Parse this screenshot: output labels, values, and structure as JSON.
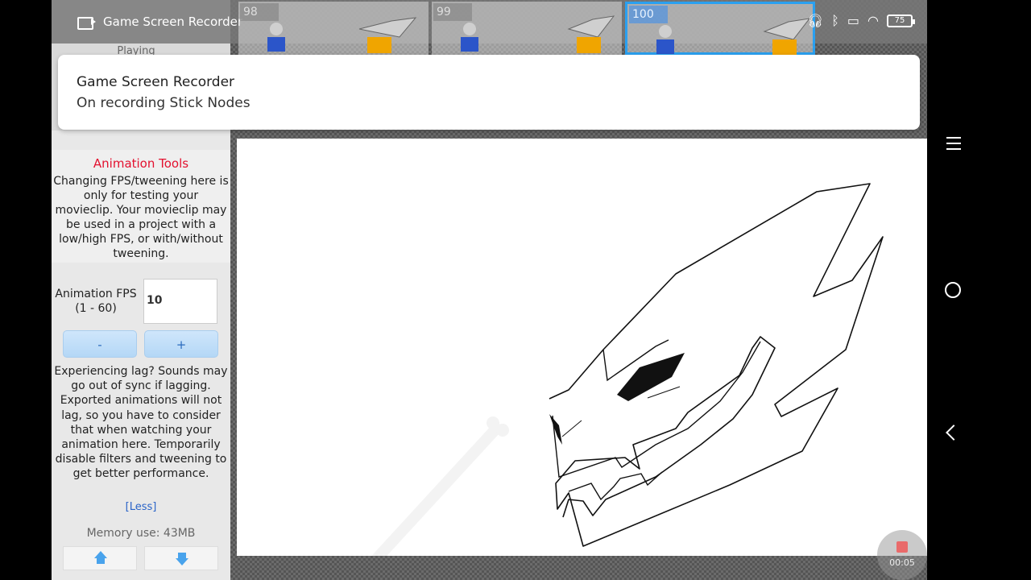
{
  "status_bar": {
    "recorder_label": "Game Screen Recorder",
    "battery": "75",
    "icons": [
      "headphones-icon",
      "bluetooth-icon",
      "cast-icon",
      "wifi-icon",
      "battery-icon"
    ]
  },
  "frames": [
    {
      "number": "98"
    },
    {
      "number": "99"
    },
    {
      "number": "100",
      "selected": true
    }
  ],
  "playing_label": "Playing",
  "notification": {
    "title": "Game Screen Recorder",
    "text": "On recording Stick Nodes"
  },
  "panel": {
    "title": "Animation Tools",
    "info": "Changing FPS/tweening here is only for testing your movieclip. Your movieclip may be used in a project with a low/high FPS, or with/without tweening.",
    "fps_label": "Animation FPS (1 - 60)",
    "fps_value": "10",
    "minus_label": "-",
    "plus_label": "+",
    "lag_text": "Experiencing lag? Sounds may go out of sync if lagging. Exported animations will not lag, so you have to consider that when watching your animation here. Temporarily disable filters and tweening to get better performance.",
    "less_link": "[Less]",
    "memory": "Memory use: 43MB"
  },
  "recorder_timer": "00:05",
  "colors": {
    "accent": "#2aa0f0",
    "title_red": "#e3112f",
    "button_blue": "#b4d7f6"
  }
}
